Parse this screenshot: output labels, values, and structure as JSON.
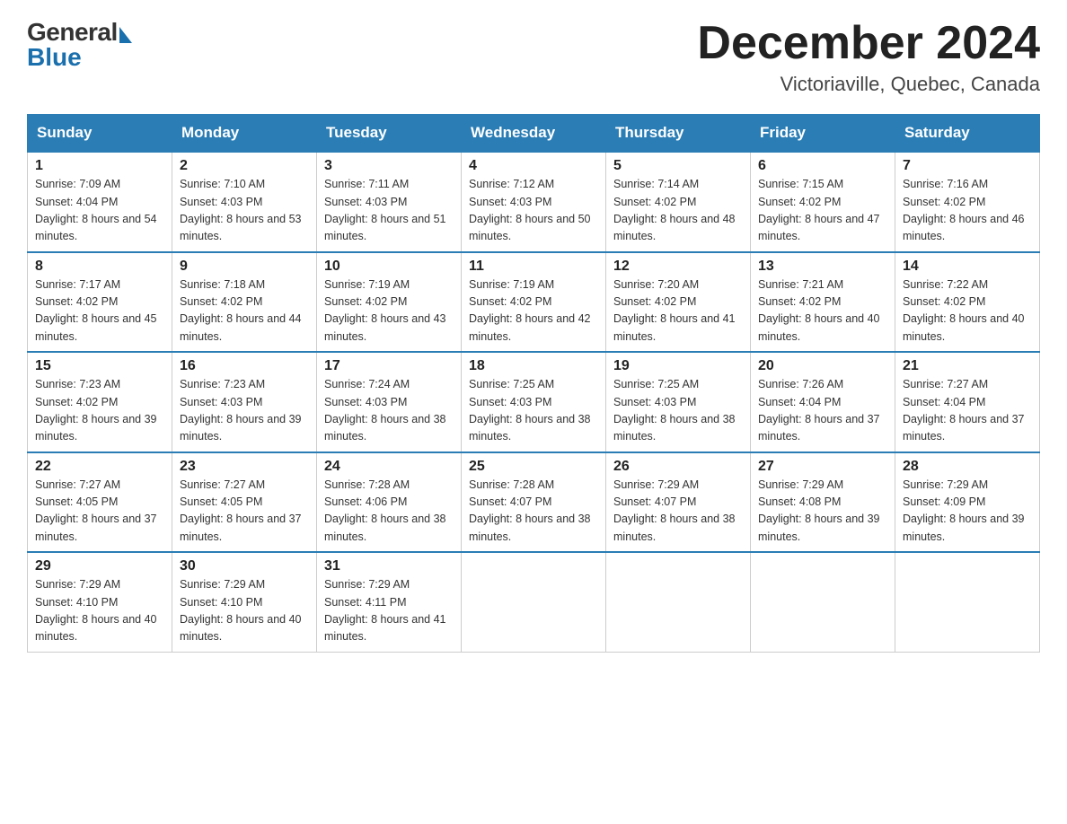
{
  "header": {
    "logo_general": "General",
    "logo_blue": "Blue",
    "month_title": "December 2024",
    "location": "Victoriaville, Quebec, Canada"
  },
  "days_of_week": [
    "Sunday",
    "Monday",
    "Tuesday",
    "Wednesday",
    "Thursday",
    "Friday",
    "Saturday"
  ],
  "weeks": [
    [
      {
        "day": "1",
        "sunrise": "7:09 AM",
        "sunset": "4:04 PM",
        "daylight": "8 hours and 54 minutes."
      },
      {
        "day": "2",
        "sunrise": "7:10 AM",
        "sunset": "4:03 PM",
        "daylight": "8 hours and 53 minutes."
      },
      {
        "day": "3",
        "sunrise": "7:11 AM",
        "sunset": "4:03 PM",
        "daylight": "8 hours and 51 minutes."
      },
      {
        "day": "4",
        "sunrise": "7:12 AM",
        "sunset": "4:03 PM",
        "daylight": "8 hours and 50 minutes."
      },
      {
        "day": "5",
        "sunrise": "7:14 AM",
        "sunset": "4:02 PM",
        "daylight": "8 hours and 48 minutes."
      },
      {
        "day": "6",
        "sunrise": "7:15 AM",
        "sunset": "4:02 PM",
        "daylight": "8 hours and 47 minutes."
      },
      {
        "day": "7",
        "sunrise": "7:16 AM",
        "sunset": "4:02 PM",
        "daylight": "8 hours and 46 minutes."
      }
    ],
    [
      {
        "day": "8",
        "sunrise": "7:17 AM",
        "sunset": "4:02 PM",
        "daylight": "8 hours and 45 minutes."
      },
      {
        "day": "9",
        "sunrise": "7:18 AM",
        "sunset": "4:02 PM",
        "daylight": "8 hours and 44 minutes."
      },
      {
        "day": "10",
        "sunrise": "7:19 AM",
        "sunset": "4:02 PM",
        "daylight": "8 hours and 43 minutes."
      },
      {
        "day": "11",
        "sunrise": "7:19 AM",
        "sunset": "4:02 PM",
        "daylight": "8 hours and 42 minutes."
      },
      {
        "day": "12",
        "sunrise": "7:20 AM",
        "sunset": "4:02 PM",
        "daylight": "8 hours and 41 minutes."
      },
      {
        "day": "13",
        "sunrise": "7:21 AM",
        "sunset": "4:02 PM",
        "daylight": "8 hours and 40 minutes."
      },
      {
        "day": "14",
        "sunrise": "7:22 AM",
        "sunset": "4:02 PM",
        "daylight": "8 hours and 40 minutes."
      }
    ],
    [
      {
        "day": "15",
        "sunrise": "7:23 AM",
        "sunset": "4:02 PM",
        "daylight": "8 hours and 39 minutes."
      },
      {
        "day": "16",
        "sunrise": "7:23 AM",
        "sunset": "4:03 PM",
        "daylight": "8 hours and 39 minutes."
      },
      {
        "day": "17",
        "sunrise": "7:24 AM",
        "sunset": "4:03 PM",
        "daylight": "8 hours and 38 minutes."
      },
      {
        "day": "18",
        "sunrise": "7:25 AM",
        "sunset": "4:03 PM",
        "daylight": "8 hours and 38 minutes."
      },
      {
        "day": "19",
        "sunrise": "7:25 AM",
        "sunset": "4:03 PM",
        "daylight": "8 hours and 38 minutes."
      },
      {
        "day": "20",
        "sunrise": "7:26 AM",
        "sunset": "4:04 PM",
        "daylight": "8 hours and 37 minutes."
      },
      {
        "day": "21",
        "sunrise": "7:27 AM",
        "sunset": "4:04 PM",
        "daylight": "8 hours and 37 minutes."
      }
    ],
    [
      {
        "day": "22",
        "sunrise": "7:27 AM",
        "sunset": "4:05 PM",
        "daylight": "8 hours and 37 minutes."
      },
      {
        "day": "23",
        "sunrise": "7:27 AM",
        "sunset": "4:05 PM",
        "daylight": "8 hours and 37 minutes."
      },
      {
        "day": "24",
        "sunrise": "7:28 AM",
        "sunset": "4:06 PM",
        "daylight": "8 hours and 38 minutes."
      },
      {
        "day": "25",
        "sunrise": "7:28 AM",
        "sunset": "4:07 PM",
        "daylight": "8 hours and 38 minutes."
      },
      {
        "day": "26",
        "sunrise": "7:29 AM",
        "sunset": "4:07 PM",
        "daylight": "8 hours and 38 minutes."
      },
      {
        "day": "27",
        "sunrise": "7:29 AM",
        "sunset": "4:08 PM",
        "daylight": "8 hours and 39 minutes."
      },
      {
        "day": "28",
        "sunrise": "7:29 AM",
        "sunset": "4:09 PM",
        "daylight": "8 hours and 39 minutes."
      }
    ],
    [
      {
        "day": "29",
        "sunrise": "7:29 AM",
        "sunset": "4:10 PM",
        "daylight": "8 hours and 40 minutes."
      },
      {
        "day": "30",
        "sunrise": "7:29 AM",
        "sunset": "4:10 PM",
        "daylight": "8 hours and 40 minutes."
      },
      {
        "day": "31",
        "sunrise": "7:29 AM",
        "sunset": "4:11 PM",
        "daylight": "8 hours and 41 minutes."
      },
      null,
      null,
      null,
      null
    ]
  ]
}
